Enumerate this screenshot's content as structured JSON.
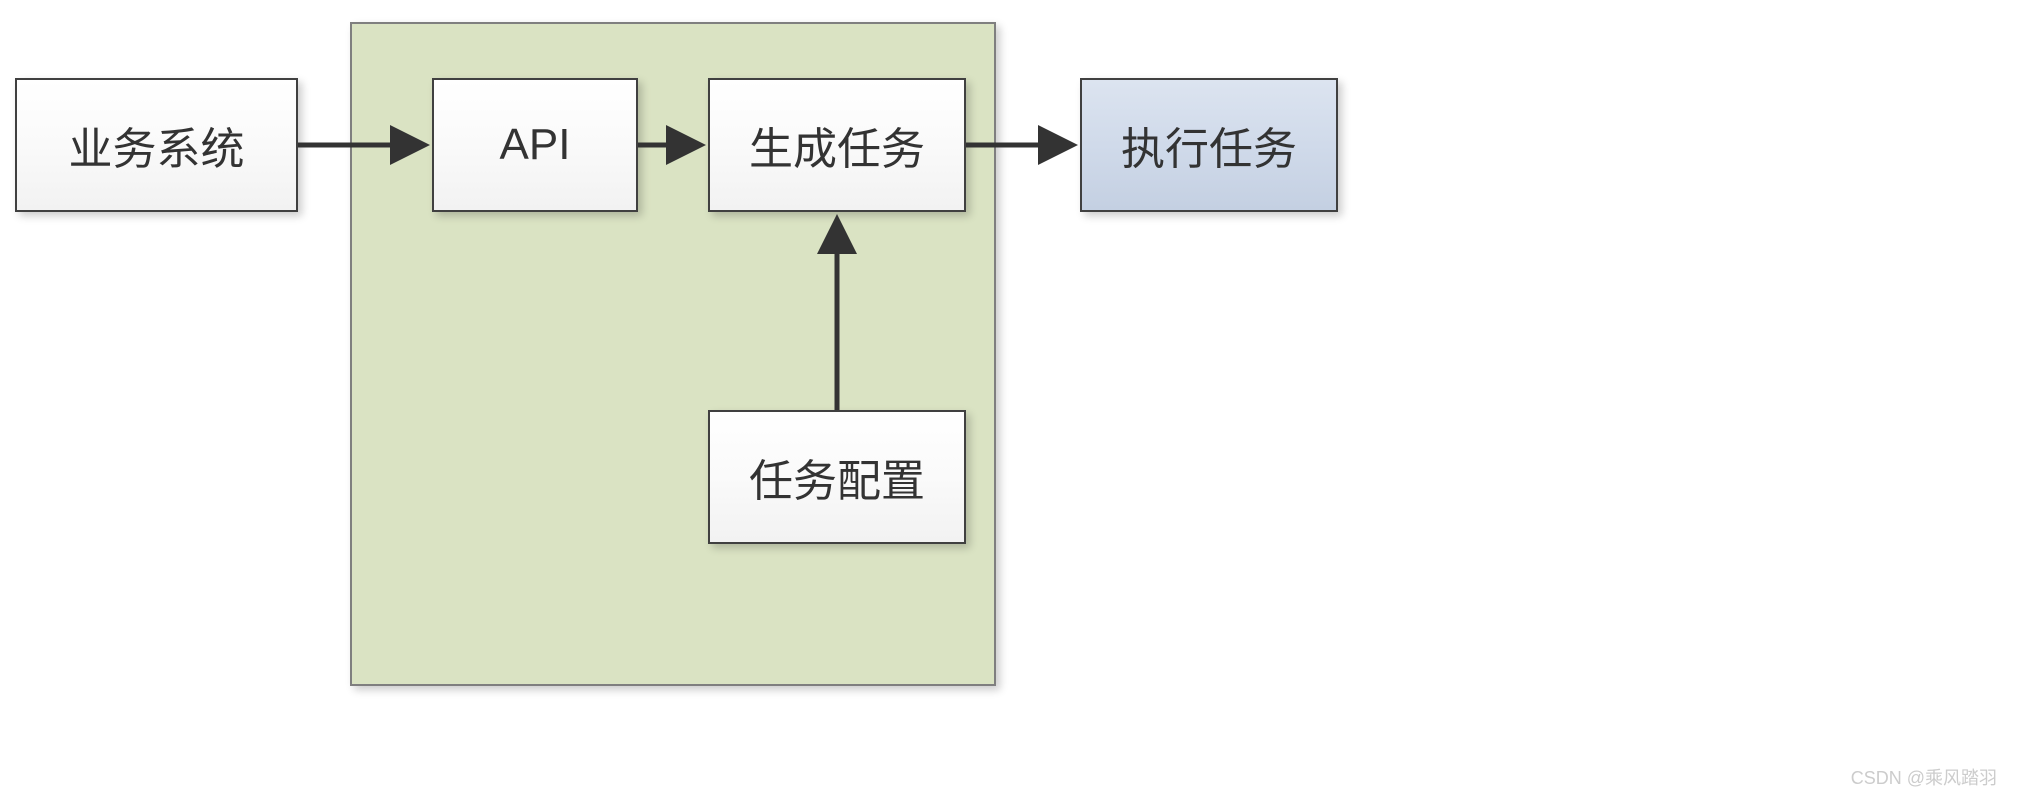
{
  "diagram": {
    "nodes": {
      "business_system": "业务系统",
      "api": "API",
      "generate_task": "生成任务",
      "task_config": "任务配置",
      "execute_task": "执行任务"
    }
  },
  "watermark": "CSDN @乘风踏羽",
  "chart_data": {
    "type": "diagram",
    "title": "",
    "nodes": [
      {
        "id": "business_system",
        "label": "业务系统",
        "style": "white"
      },
      {
        "id": "api",
        "label": "API",
        "style": "white",
        "container": "green_group"
      },
      {
        "id": "generate_task",
        "label": "生成任务",
        "style": "white",
        "container": "green_group"
      },
      {
        "id": "task_config",
        "label": "任务配置",
        "style": "white",
        "container": "green_group"
      },
      {
        "id": "execute_task",
        "label": "执行任务",
        "style": "blue"
      }
    ],
    "containers": [
      {
        "id": "green_group",
        "style": "green"
      }
    ],
    "edges": [
      {
        "from": "business_system",
        "to": "api",
        "direction": "right"
      },
      {
        "from": "api",
        "to": "generate_task",
        "direction": "right"
      },
      {
        "from": "task_config",
        "to": "generate_task",
        "direction": "up"
      },
      {
        "from": "generate_task",
        "to": "execute_task",
        "direction": "right"
      }
    ]
  }
}
